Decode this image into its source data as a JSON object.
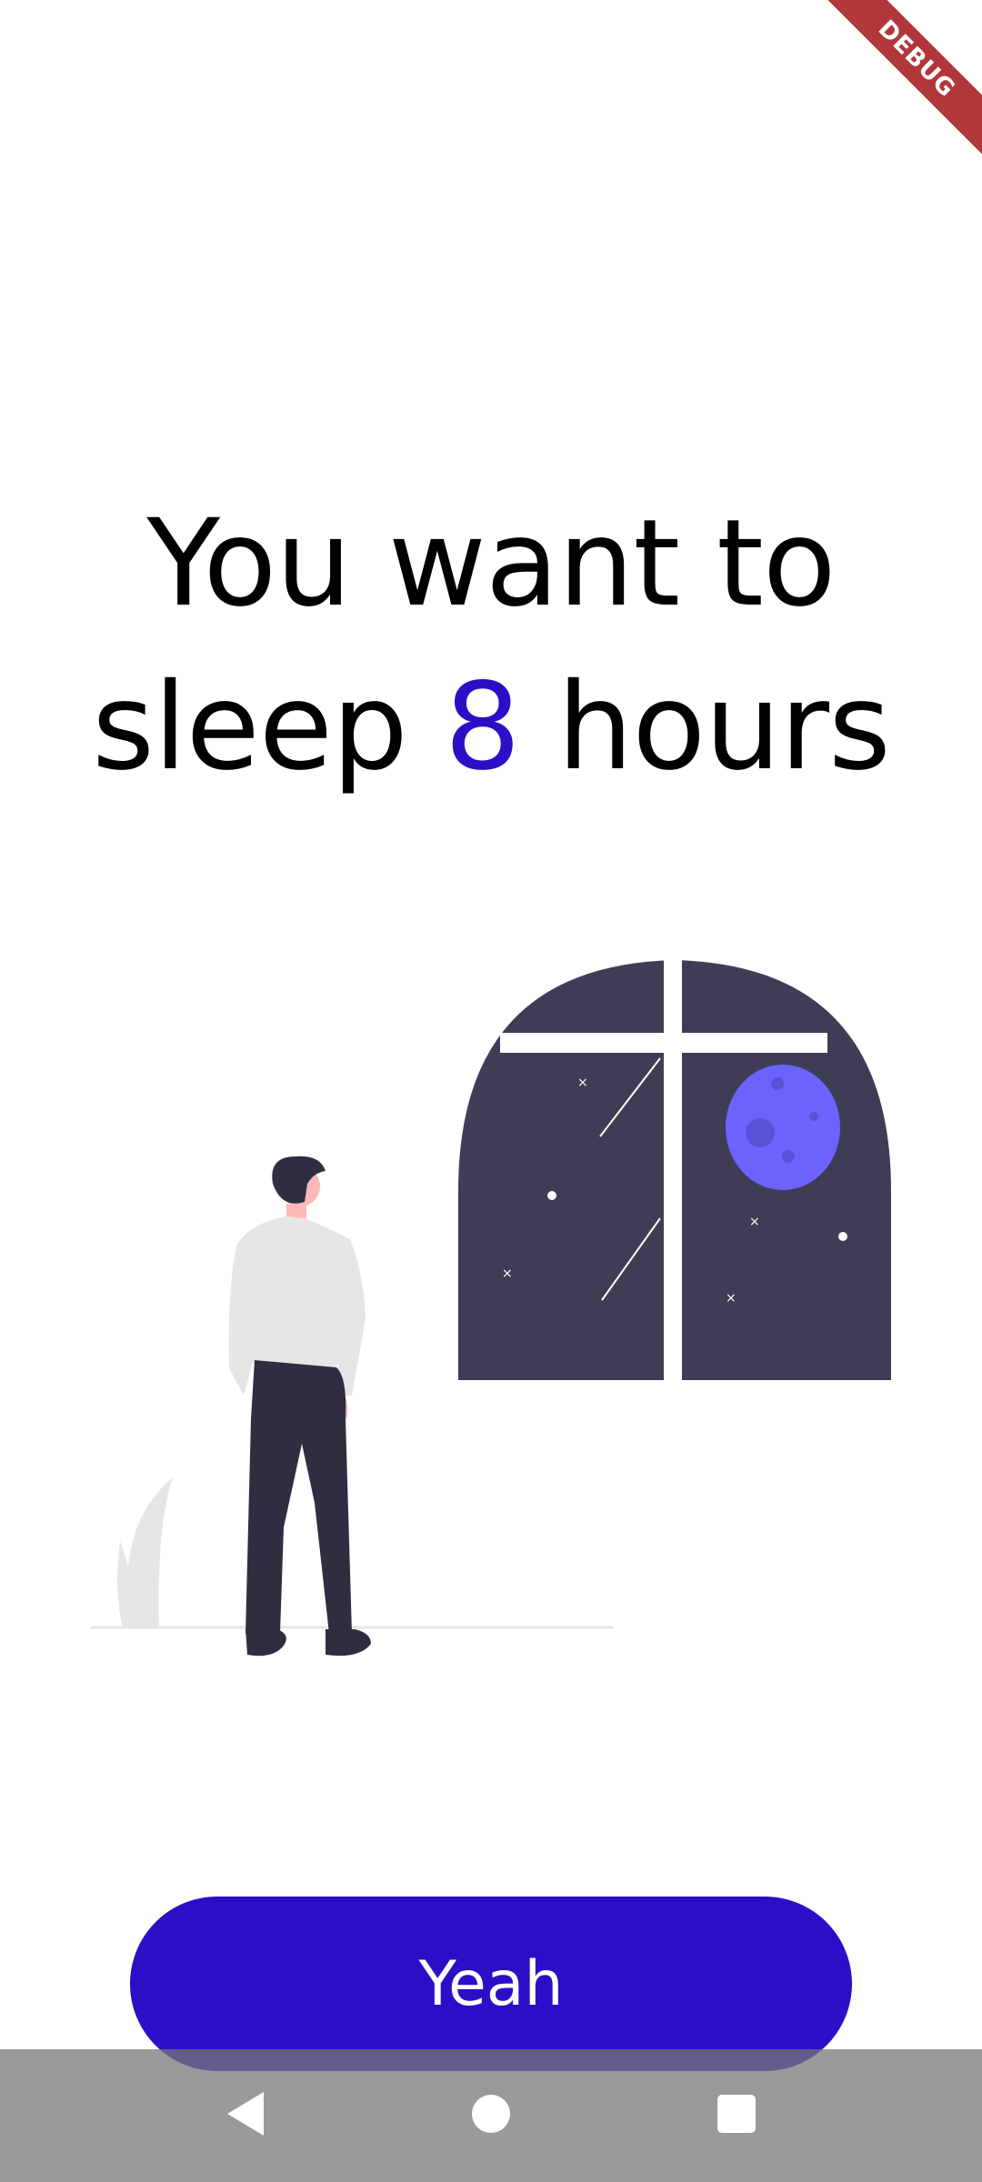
{
  "debug_banner": {
    "label": "DEBUG",
    "color": "#b2373b"
  },
  "headline": {
    "line1": "You want to",
    "line2_prefix": "sleep ",
    "line2_highlight": "8",
    "line2_suffix": " hours",
    "highlight_color": "#2a0fc7"
  },
  "illustration": {
    "window_color": "#3f3d56",
    "moon_color": "#6c63ff",
    "icons": [
      "person-icon",
      "window-icon",
      "moon-icon",
      "grass-icon"
    ]
  },
  "primary_button": {
    "label": "Yeah",
    "color": "#2a0fc7"
  },
  "nav_bar": {
    "icons": [
      "back-icon",
      "home-icon",
      "recents-icon"
    ]
  }
}
